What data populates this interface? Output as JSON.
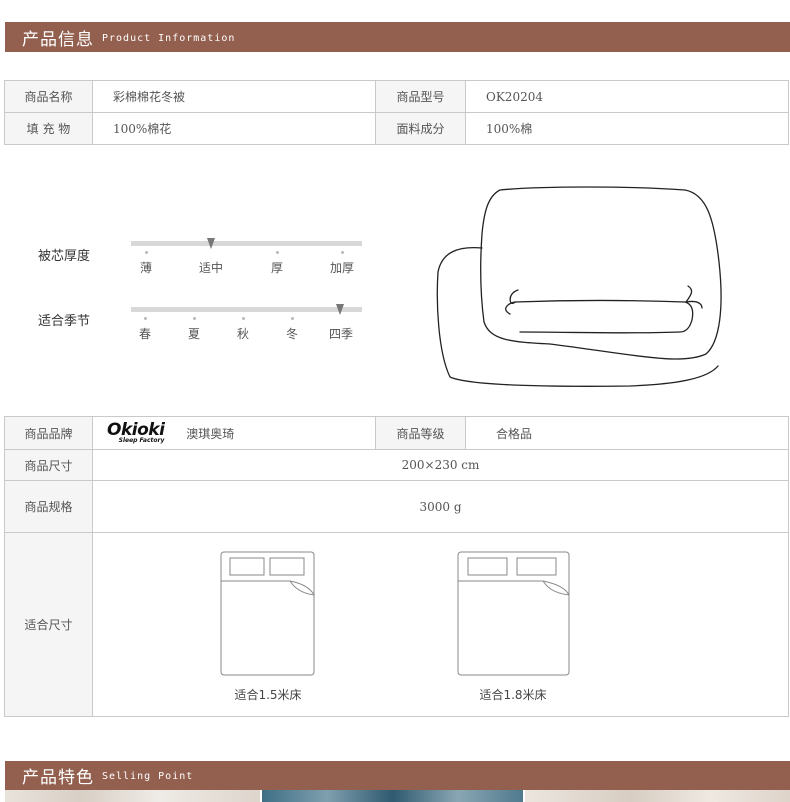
{
  "sections": {
    "info": {
      "title_cn": "产品信息",
      "title_en": "Product Information"
    },
    "selling": {
      "title_cn": "产品特色",
      "title_en": "Selling Point"
    }
  },
  "top_table": {
    "name_label": "商品名称",
    "name_value": "彩棉棉花冬被",
    "model_label": "商品型号",
    "model_value": "OK20204",
    "filling_label": "填 充 物",
    "filling_value": "100%棉花",
    "fabric_label": "面料成分",
    "fabric_value": "100%棉"
  },
  "thickness": {
    "label": "被芯厚度",
    "options": [
      "薄",
      "适中",
      "厚",
      "加厚"
    ],
    "selected_index": 1
  },
  "season": {
    "label": "适合季节",
    "options": [
      "春",
      "夏",
      "秋",
      "冬",
      "四季"
    ],
    "selected_index": 4
  },
  "bottom_table": {
    "brand_label": "商品品牌",
    "brand_logo_text": "Okioki",
    "brand_logo_sub": "Sleep Factory",
    "brand_name": "澳琪奥琦",
    "grade_label": "商品等级",
    "grade_value": "合格品",
    "size_label": "商品尺寸",
    "size_value": "200×230 cm",
    "spec_label": "商品规格",
    "spec_value": "3000 g",
    "fit_label": "适合尺寸",
    "beds": [
      {
        "caption": "适合1.5米床"
      },
      {
        "caption": "适合1.8米床"
      }
    ]
  },
  "colors": {
    "banner": "#93604f",
    "border": "#c9c9c9",
    "label_bg": "#f5f5f5",
    "track": "#d8d8d8",
    "marker": "#777777"
  }
}
